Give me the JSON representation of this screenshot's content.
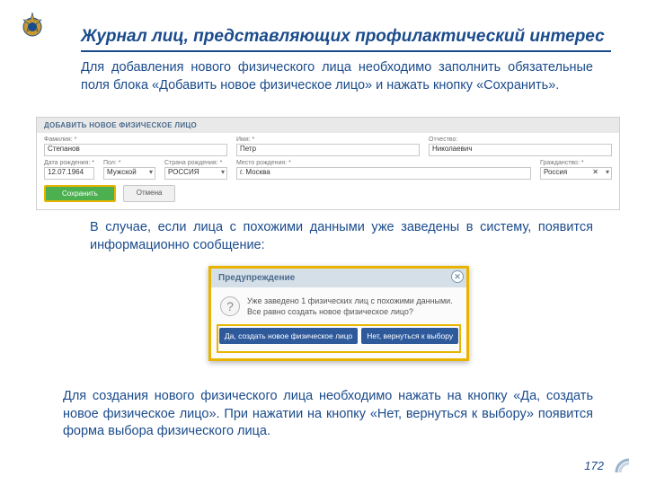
{
  "page": {
    "title": "Журнал лиц, представляющих профилактический интерес",
    "para1": "Для добавления нового физического лица необходимо заполнить обязательные поля блока «Добавить новое физическое лицо» и нажать кнопку «Сохранить».",
    "para2": "В случае, если лица с похожими данными уже заведены в систему, появится информационно сообщение:",
    "para3": "Для создания нового физического лица необходимо нажать на кнопку «Да, создать новое физическое лицо». При нажатии на кнопку «Нет, вернуться к выбору» появится форма выбора физического лица.",
    "number": "172"
  },
  "form": {
    "header": "ДОБАВИТЬ НОВОЕ ФИЗИЧЕСКОЕ ЛИЦО",
    "labels": {
      "surname": "Фамилия: *",
      "name": "Имя: *",
      "patronymic": "Отчество:",
      "dob": "Дата рождения: *",
      "sex": "Пол: *",
      "country": "Страна рождения: *",
      "birthplace": "Место рождения: *",
      "citizenship": "Гражданство: *"
    },
    "values": {
      "surname": "Степанов",
      "name": "Петр",
      "patronymic": "Николаевич",
      "dob": "12.07.1964",
      "sex": "Мужской",
      "country": "РОССИЯ",
      "birthplace": "г. Москва",
      "citizenship": "Россия"
    },
    "buttons": {
      "save": "Сохранить",
      "cancel": "Отмена"
    }
  },
  "dialog": {
    "title": "Предупреждение",
    "message": "Уже заведено 1 физических лиц с похожими данными. Все равно создать новое физическое лицо?",
    "yes": "Да, создать новое физическое лицо",
    "no": "Нет, вернуться к выбору"
  }
}
